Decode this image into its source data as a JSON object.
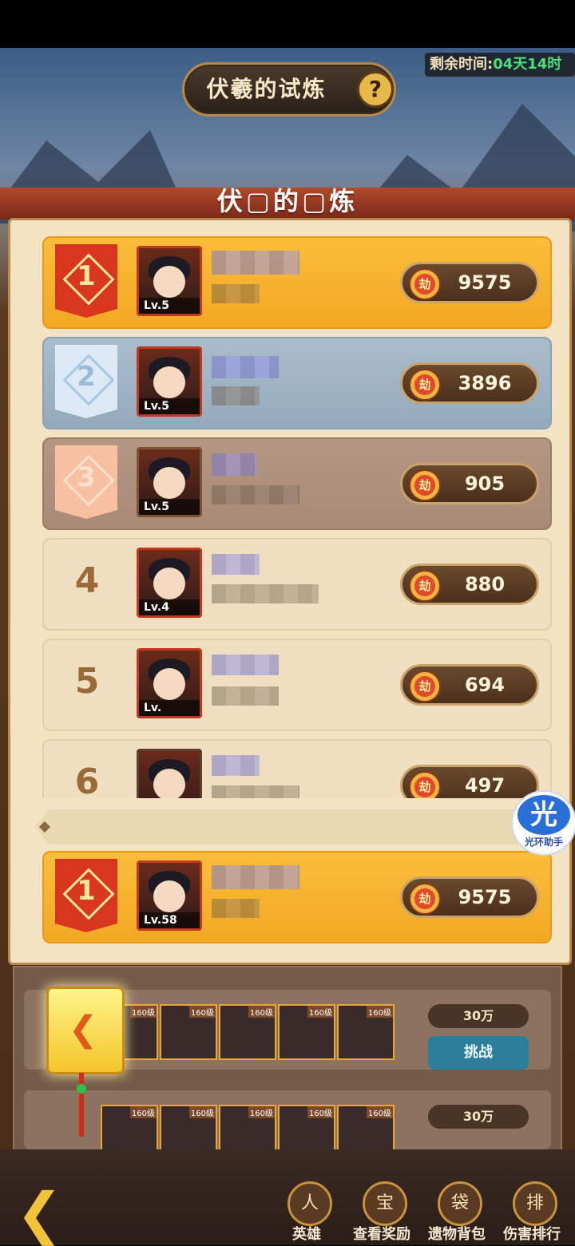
{
  "header": {
    "title": "伏羲的试炼",
    "help_icon": "?",
    "timer_label": "剩余时间:",
    "timer_value": "04天14时"
  },
  "panel": {
    "title": "伏▢的▢炼"
  },
  "leaderboard": [
    {
      "rank": "1",
      "level": "Lv.5",
      "score": "9575",
      "style": "gold"
    },
    {
      "rank": "2",
      "level": "Lv.5",
      "score": "3896",
      "style": "silver"
    },
    {
      "rank": "3",
      "level": "Lv.5",
      "score": "905",
      "style": "bronze"
    },
    {
      "rank": "4",
      "level": "Lv.4",
      "score": "880",
      "style": "plain"
    },
    {
      "rank": "5",
      "level": "Lv.",
      "score": "694",
      "style": "plain"
    },
    {
      "rank": "6",
      "level": "",
      "score": "497",
      "style": "plain"
    }
  ],
  "my_rank": {
    "rank": "1",
    "level": "Lv.58",
    "score": "9575"
  },
  "coin_glyph": "劫",
  "assistant": {
    "glyph": "光",
    "label": "光环助手"
  },
  "teams": [
    {
      "power": "30万",
      "action": "挑战",
      "hero_tag": "160级"
    },
    {
      "power": "30万",
      "action": "",
      "hero_tag": "160级"
    }
  ],
  "nav": [
    {
      "label": "英雄",
      "icon": "hero-icon"
    },
    {
      "label": "查看奖励",
      "icon": "chest-icon"
    },
    {
      "label": "遗物背包",
      "icon": "bag-icon"
    },
    {
      "label": "伤害排行",
      "icon": "ranking-icon"
    }
  ],
  "nav_icon_glyphs": {
    "hero": "人",
    "chest": "宝",
    "bag": "袋",
    "rank": "排"
  }
}
